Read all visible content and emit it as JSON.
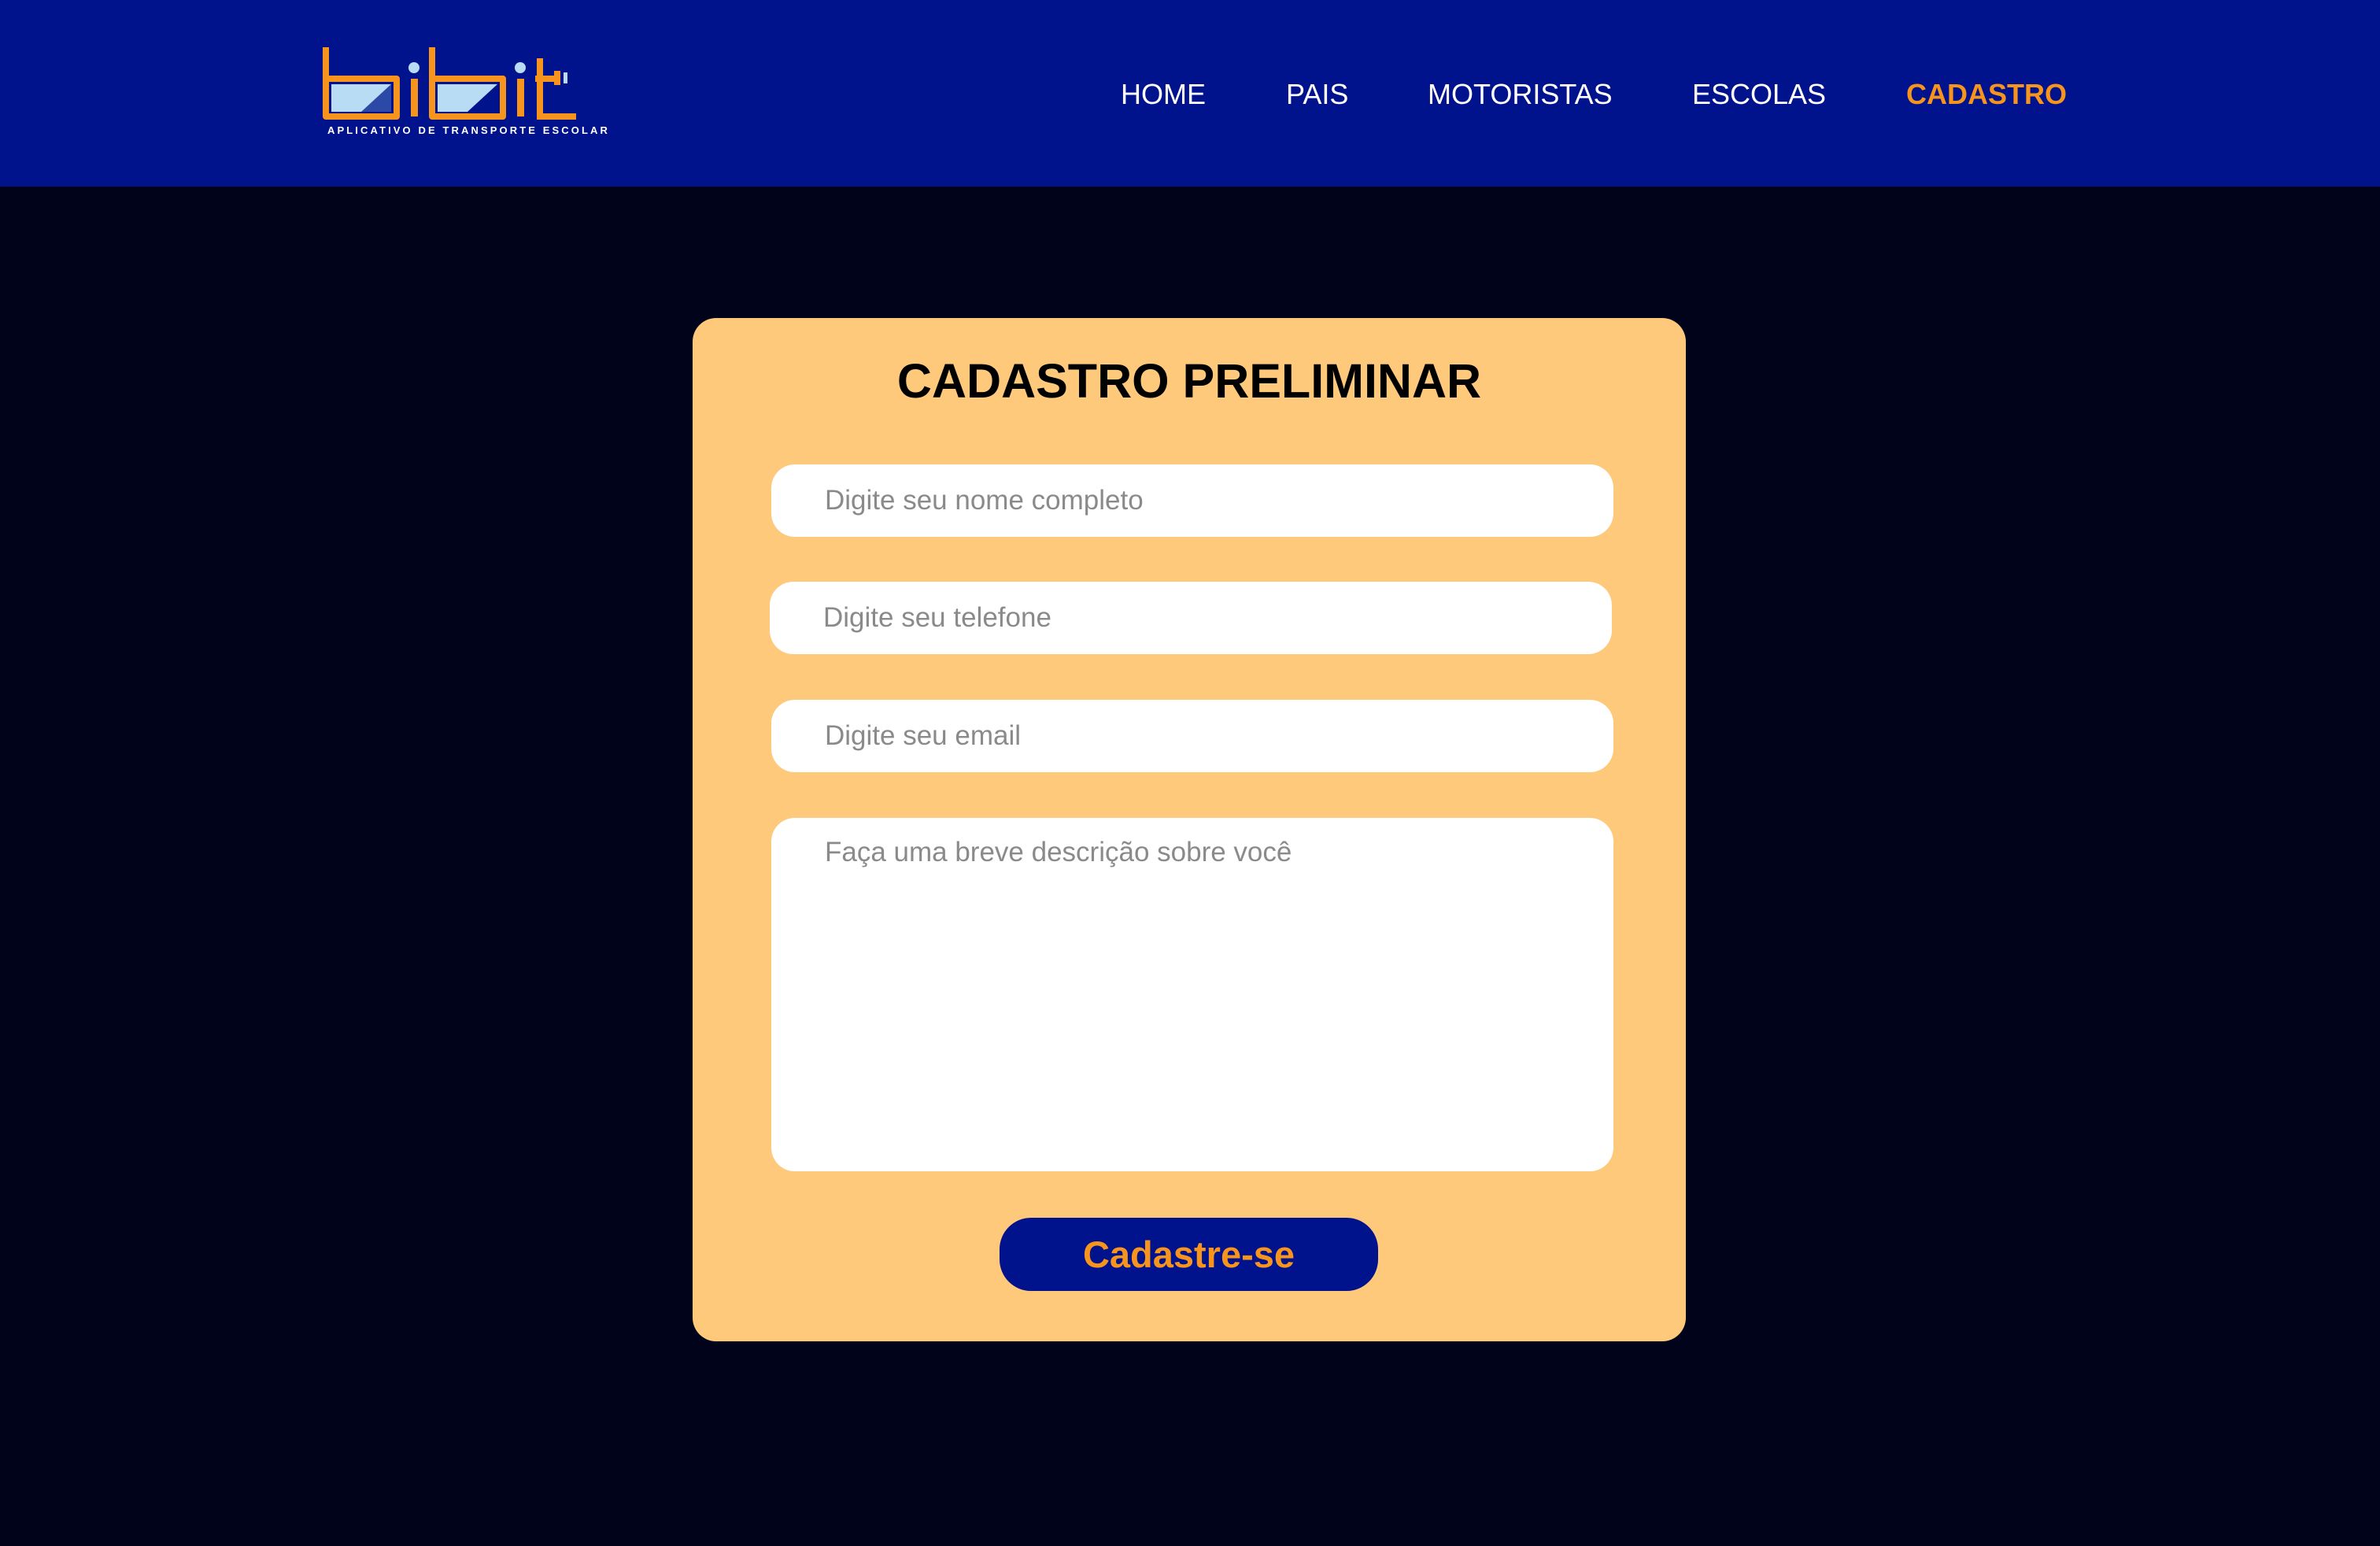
{
  "header": {
    "logo": {
      "wordmark": "bibit",
      "tagline": "APLICATIVO DE TRANSPORTE ESCOLAR"
    },
    "nav": [
      {
        "label": "HOME",
        "active": false
      },
      {
        "label": "PAIS",
        "active": false
      },
      {
        "label": "MOTORISTAS",
        "active": false
      },
      {
        "label": "ESCOLAS",
        "active": false
      },
      {
        "label": "CADASTRO",
        "active": true
      }
    ]
  },
  "form": {
    "title": "CADASTRO PRELIMINAR",
    "name_placeholder": "Digite seu nome completo",
    "phone_placeholder": "Digite seu telefone",
    "email_placeholder": "Digite seu email",
    "description_placeholder": "Faça uma breve descrição sobre você",
    "submit_label": "Cadastre-se"
  },
  "colors": {
    "header_bg": "#01128d",
    "page_bg": "#000319",
    "card_bg": "#fec97b",
    "accent": "#f7941d",
    "logo_window": "#b9dcf5"
  }
}
